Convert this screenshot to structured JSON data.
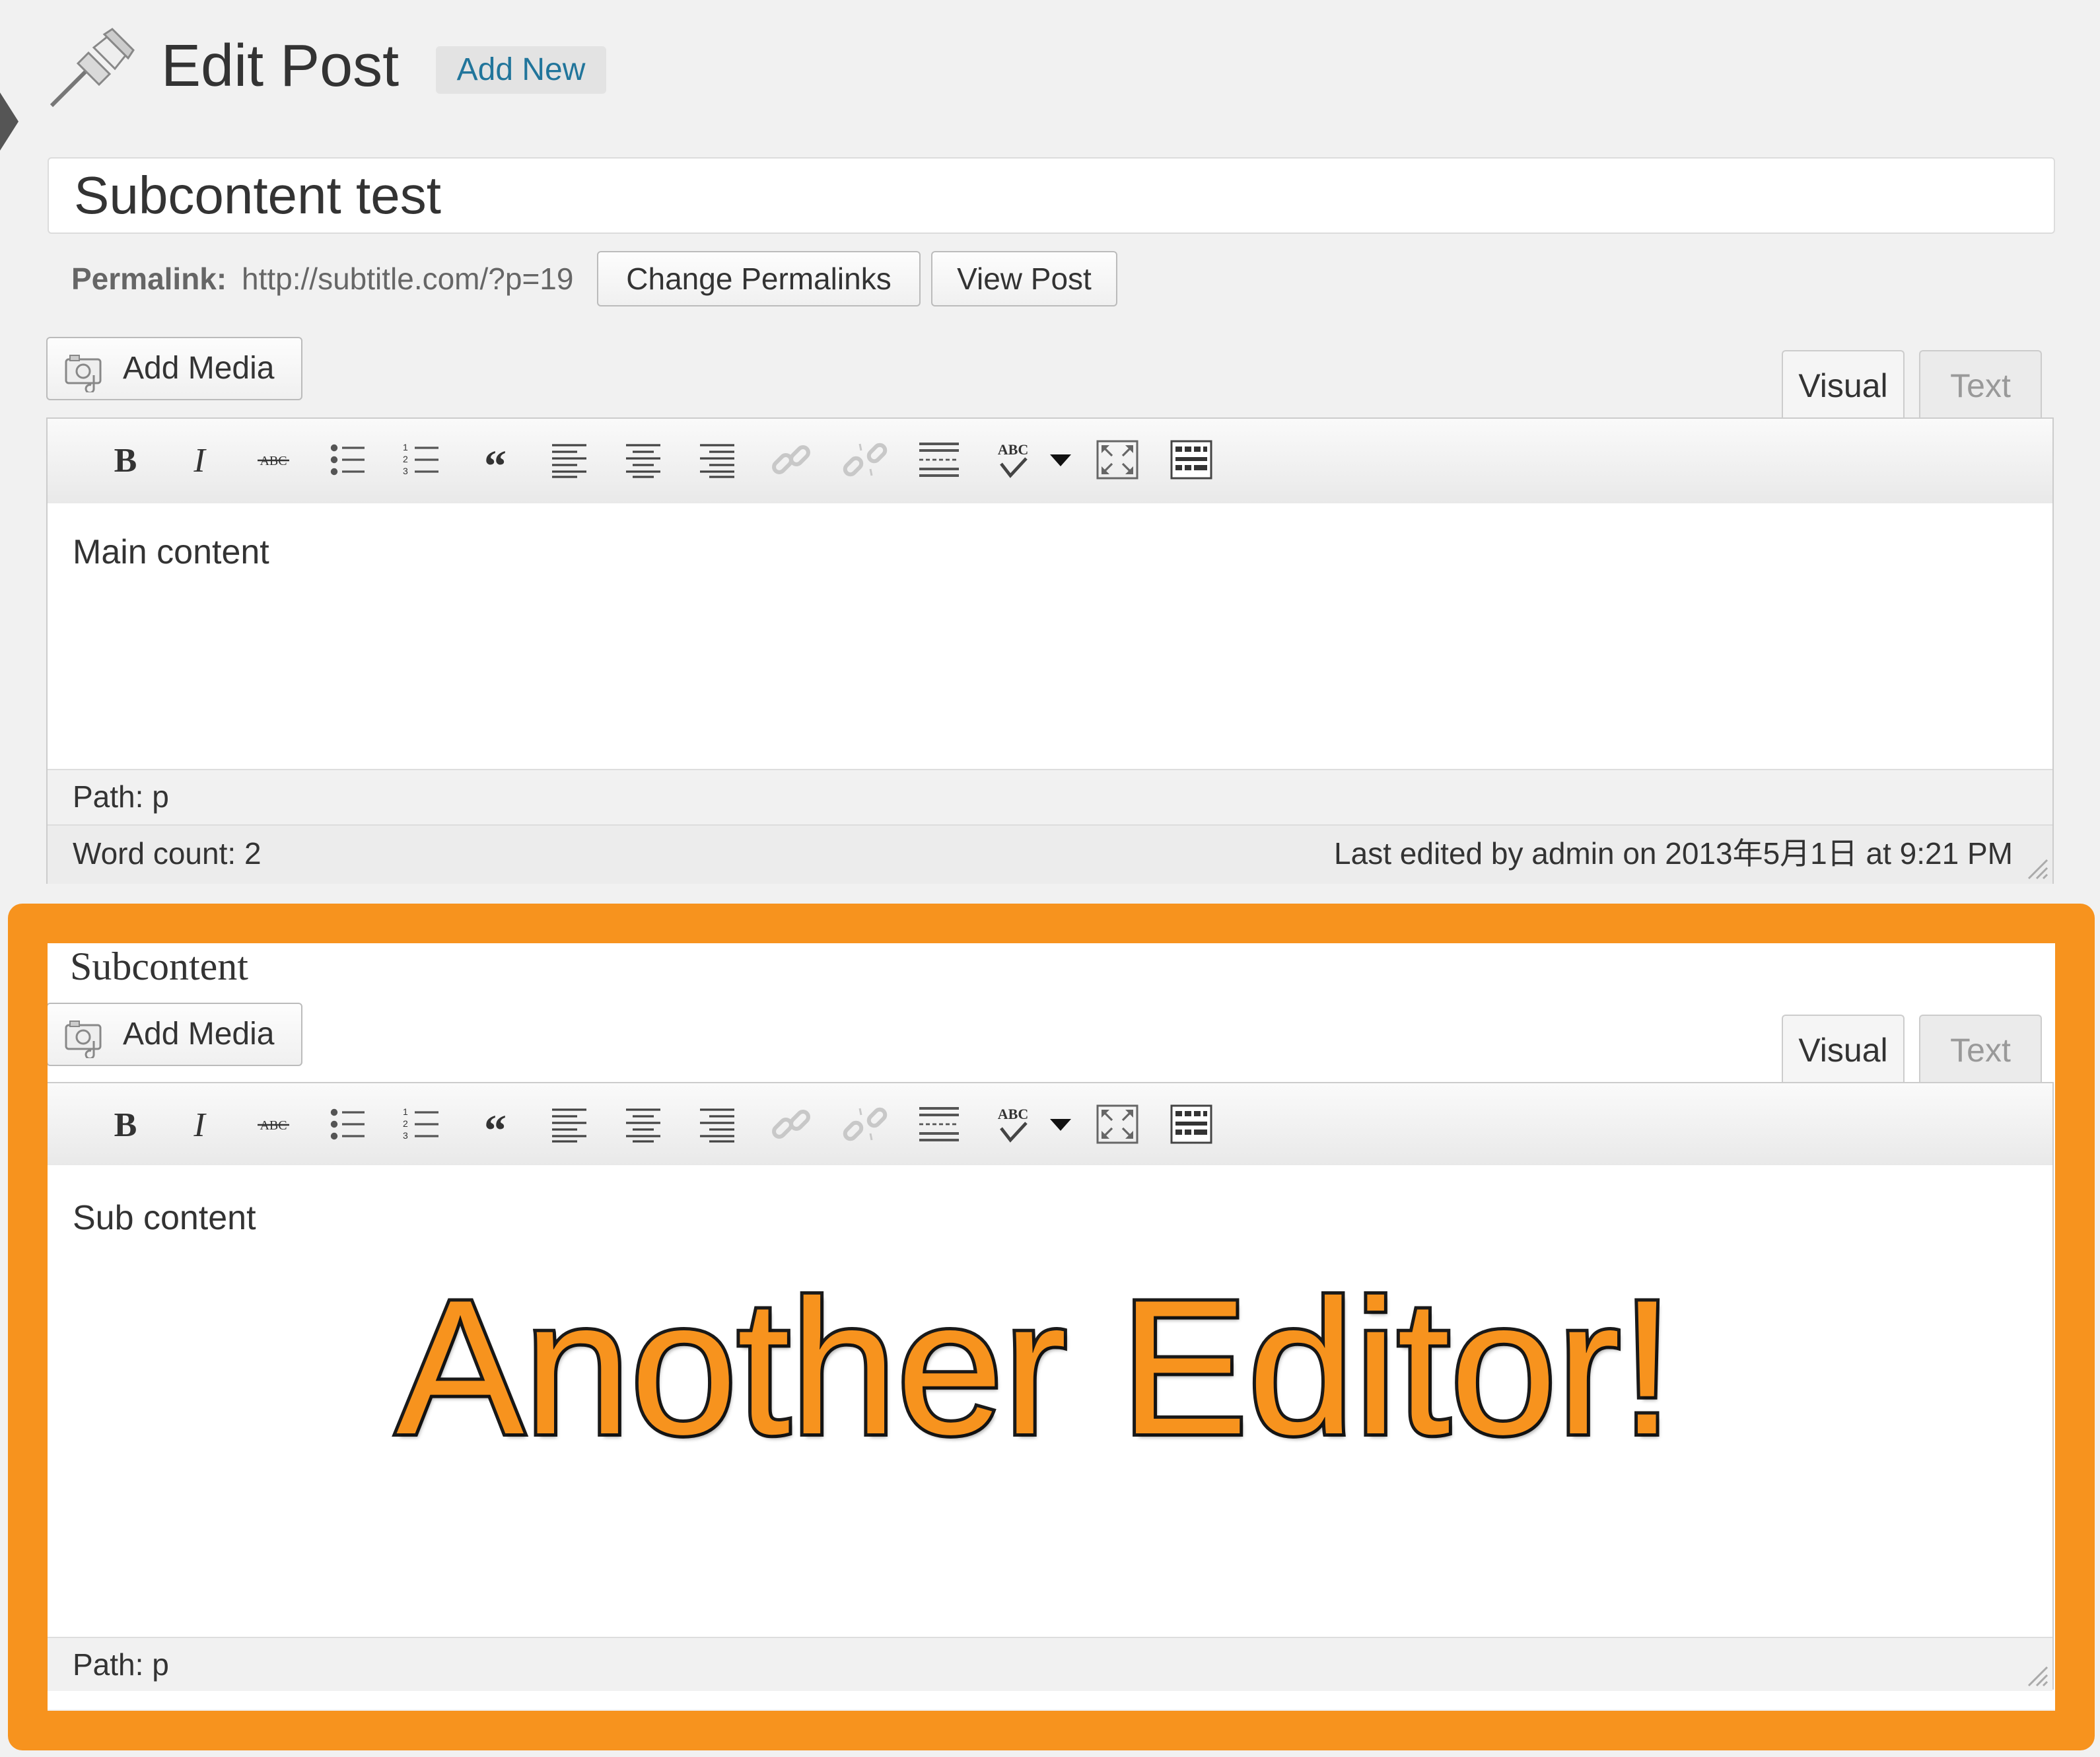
{
  "header": {
    "title": "Edit Post",
    "add_new_label": "Add New"
  },
  "post": {
    "title_value": "Subcontent test",
    "permalink_label": "Permalink:",
    "permalink_url": "http://subtitle.com/?p=19",
    "change_permalinks_label": "Change Permalinks",
    "view_post_label": "View Post"
  },
  "main_editor": {
    "add_media_label": "Add Media",
    "tabs": [
      {
        "label": "Visual",
        "active": true
      },
      {
        "label": "Text",
        "active": false
      }
    ],
    "content": "Main content",
    "path": "Path: p",
    "word_count": "Word count: 2",
    "last_edited": "Last edited by admin on 2013年5月1日 at 9:21 PM"
  },
  "sub_editor": {
    "heading": "Subcontent",
    "add_media_label": "Add Media",
    "tabs": [
      {
        "label": "Visual",
        "active": true
      },
      {
        "label": "Text",
        "active": false
      }
    ],
    "content": "Sub content",
    "path": "Path: p"
  },
  "toolbar_buttons": [
    "bold-icon",
    "italic-icon",
    "strikethrough-icon",
    "bullet-list-icon",
    "numbered-list-icon",
    "blockquote-icon",
    "align-left-icon",
    "align-center-icon",
    "align-right-icon",
    "link-icon",
    "unlink-icon",
    "more-tag-icon",
    "spellcheck-icon",
    "spellcheck-dropdown-icon",
    "fullscreen-icon",
    "kitchen-sink-icon"
  ],
  "annotation": {
    "callout_text": "Another Editor!"
  },
  "colors": {
    "highlight": "#f7931e",
    "link": "#21759b",
    "background": "#f1f1f1"
  }
}
